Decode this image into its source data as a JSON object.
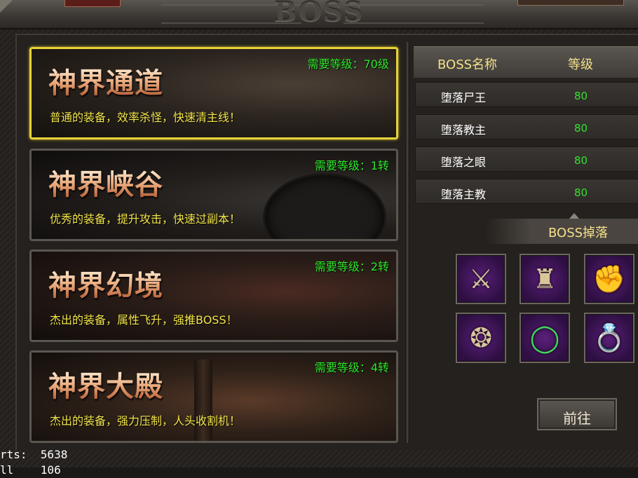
{
  "window": {
    "title": "BOSS"
  },
  "zones": [
    {
      "name": "神界通道",
      "requirement": "需要等级：70级",
      "desc": "普通的装备，效率杀怪，快速清主线！",
      "selected": true
    },
    {
      "name": "神界峡谷",
      "requirement": "需要等级：1转",
      "desc": "优秀的装备，提升攻击，快速过副本！"
    },
    {
      "name": "神界幻境",
      "requirement": "需要等级：2转",
      "desc": "杰出的装备，属性飞升，强推BOSS！"
    },
    {
      "name": "神界大殿",
      "requirement": "需要等级：4转",
      "desc": "杰出的装备，强力压制，人头收割机！"
    }
  ],
  "boss_table": {
    "header": {
      "name": "BOSS名称",
      "level": "等级"
    },
    "rows": [
      {
        "name": "堕落尸王",
        "level": "80"
      },
      {
        "name": "堕落教主",
        "level": "80"
      },
      {
        "name": "堕落之眼",
        "level": "80"
      },
      {
        "name": "堕落主教",
        "level": "80"
      }
    ]
  },
  "drops": {
    "title": "BOSS掉落",
    "items": [
      {
        "icon": "blade-icon"
      },
      {
        "icon": "armor-icon"
      },
      {
        "icon": "gauntlet-icon"
      },
      {
        "icon": "claw-bracelet-icon"
      },
      {
        "icon": "bead-bracelet-icon"
      },
      {
        "icon": "ring-icon"
      }
    ]
  },
  "go_button": "前往",
  "debug": {
    "line1": "rts:  5638",
    "line2": "ll    106"
  },
  "colors": {
    "requirement": "#2ee82a",
    "description": "#f2e54a",
    "header": "#f4e08a",
    "selected_border": "#e8d23a"
  }
}
